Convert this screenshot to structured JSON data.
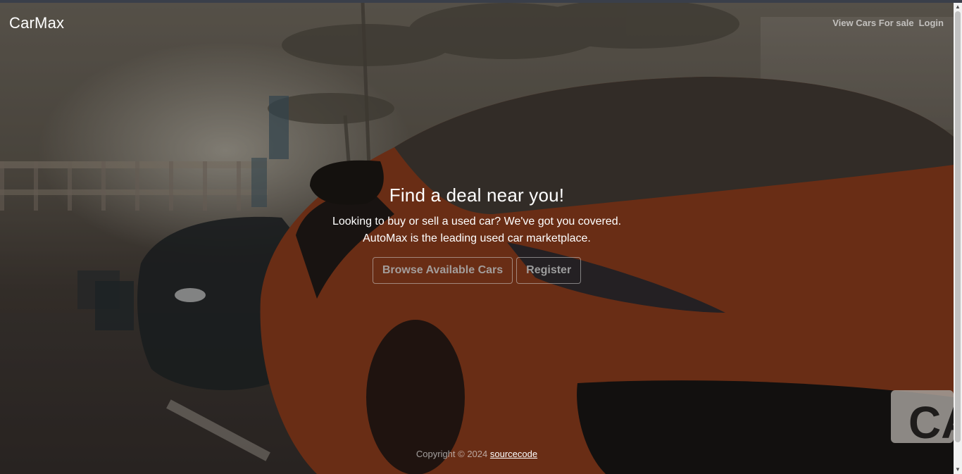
{
  "navbar": {
    "brand": "CarMax",
    "links": [
      "View Cars For sale",
      "Login"
    ]
  },
  "hero": {
    "title": "Find a deal near you!",
    "line1": "Looking to buy or sell a used car? We've got you covered.",
    "line2": "AutoMax is the leading used car marketplace.",
    "buttons": [
      "Browse Available Cars",
      "Register"
    ],
    "background_icon": "car-photo-background"
  },
  "footer": {
    "prefix": "Copyright © 2024",
    "link": "sourcecode"
  },
  "scrollbar": {
    "up_icon": "▲",
    "down_icon": "▼"
  }
}
